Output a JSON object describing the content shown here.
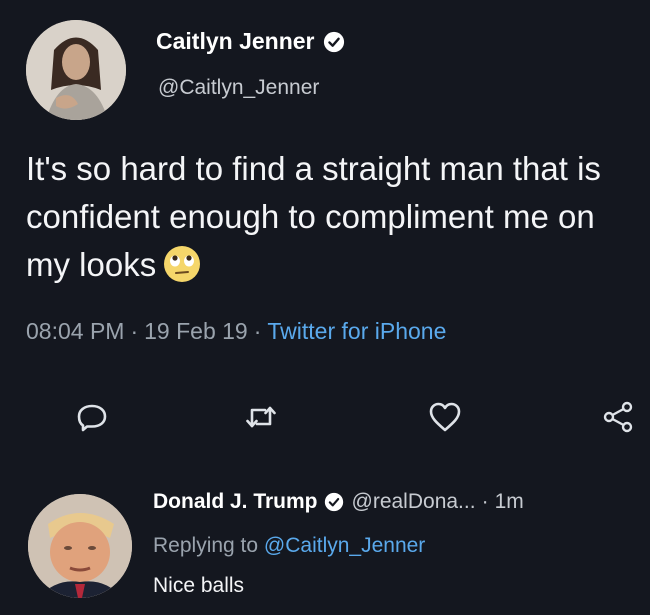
{
  "tweet": {
    "author": {
      "name": "Caitlyn Jenner",
      "handle": "@Caitlyn_Jenner",
      "verified": true
    },
    "text": "It's so hard to find a straight man that is confident enough to compliment me on my looks",
    "emoji": "face-with-rolling-eyes",
    "time": "08:04 PM",
    "date": "19 Feb 19",
    "source": "Twitter for iPhone",
    "separator": "·",
    "actions": [
      "reply-icon",
      "retweet-icon",
      "like-icon",
      "share-icon"
    ]
  },
  "reply": {
    "author": {
      "name": "Donald J. Trump",
      "handle": "@realDona...",
      "verified": true
    },
    "time": "1m",
    "separator": "·",
    "replying_prefix": "Replying to ",
    "replying_to": "@Caitlyn_Jenner",
    "text": "Nice balls"
  },
  "colors": {
    "background": "#14171f",
    "link": "#5aa9ec",
    "muted": "#9aa3ad",
    "text": "#f4f5f7"
  }
}
